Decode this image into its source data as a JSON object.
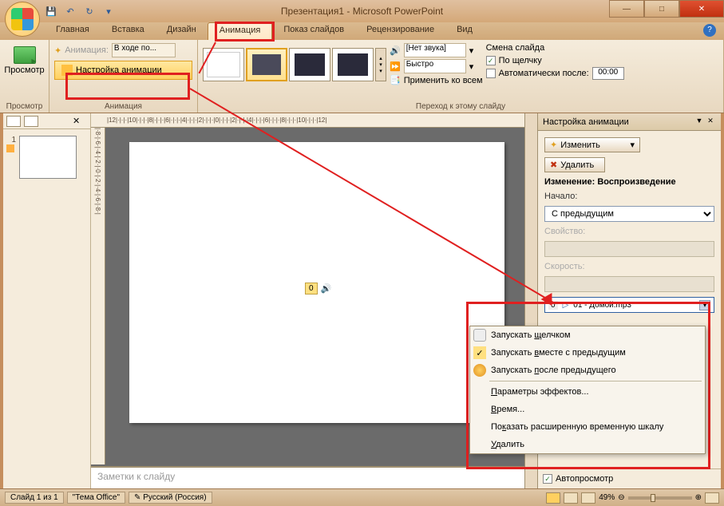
{
  "title": "Презентация1 - Microsoft PowerPoint",
  "tabs": {
    "home": "Главная",
    "insert": "Вставка",
    "design": "Дизайн",
    "animation": "Анимация",
    "slideshow": "Показ слайдов",
    "review": "Рецензирование",
    "view": "Вид"
  },
  "ribbon": {
    "preview": "Просмотр",
    "preview_group": "Просмотр",
    "anim_label": "Анимация:",
    "anim_value": "В ходе по...",
    "custom_anim": "Настройка анимации",
    "anim_group": "Анимация",
    "sound_label": "[Нет звука]",
    "speed_label": "Быстро",
    "apply_all": "Применить ко всем",
    "advance_title": "Смена слайда",
    "on_click": "По щелчку",
    "auto_after": "Автоматически после:",
    "auto_time": "00:00",
    "transition_group": "Переход к этому слайду"
  },
  "taskpane": {
    "title": "Настройка анимации",
    "change": "Изменить",
    "delete": "Удалить",
    "section": "Изменение: Воспроизведение",
    "start_label": "Начало:",
    "start_value": "С предыдущим",
    "property_label": "Свойство:",
    "speed_label": "Скорость:",
    "effect_num": "0",
    "effect_name": "01 - Домой.mp3",
    "autopreview": "Автопросмотр"
  },
  "slide": {
    "sound_num": "0",
    "notes_placeholder": "Заметки к слайду"
  },
  "ctx": {
    "on_click": "Запускать щелчком",
    "with_prev": "Запускать вместе с предыдущим",
    "after_prev": "Запускать после предыдущего",
    "effect_opts": "Параметры эффектов...",
    "timing": "Время...",
    "timeline": "Показать расширенную временную шкалу",
    "remove": "Удалить"
  },
  "status": {
    "slide": "Слайд 1 из 1",
    "theme": "\"Тема Office\"",
    "lang": "Русский (Россия)",
    "zoom": "49%"
  },
  "ruler_h": "|12|·|·|·|10|·|·|·|8|·|·|·|6|·|·|·|4|·|·|·|2|·|·|·|0|·|·|·|2|·|·|·|4|·|·|·|6|·|·|·|8|·|·|·|10|·|·|·|12|",
  "ruler_v": "|·8·|·6·|·4·|·2·|·0·|·2·|·4·|·6·|·8·|"
}
